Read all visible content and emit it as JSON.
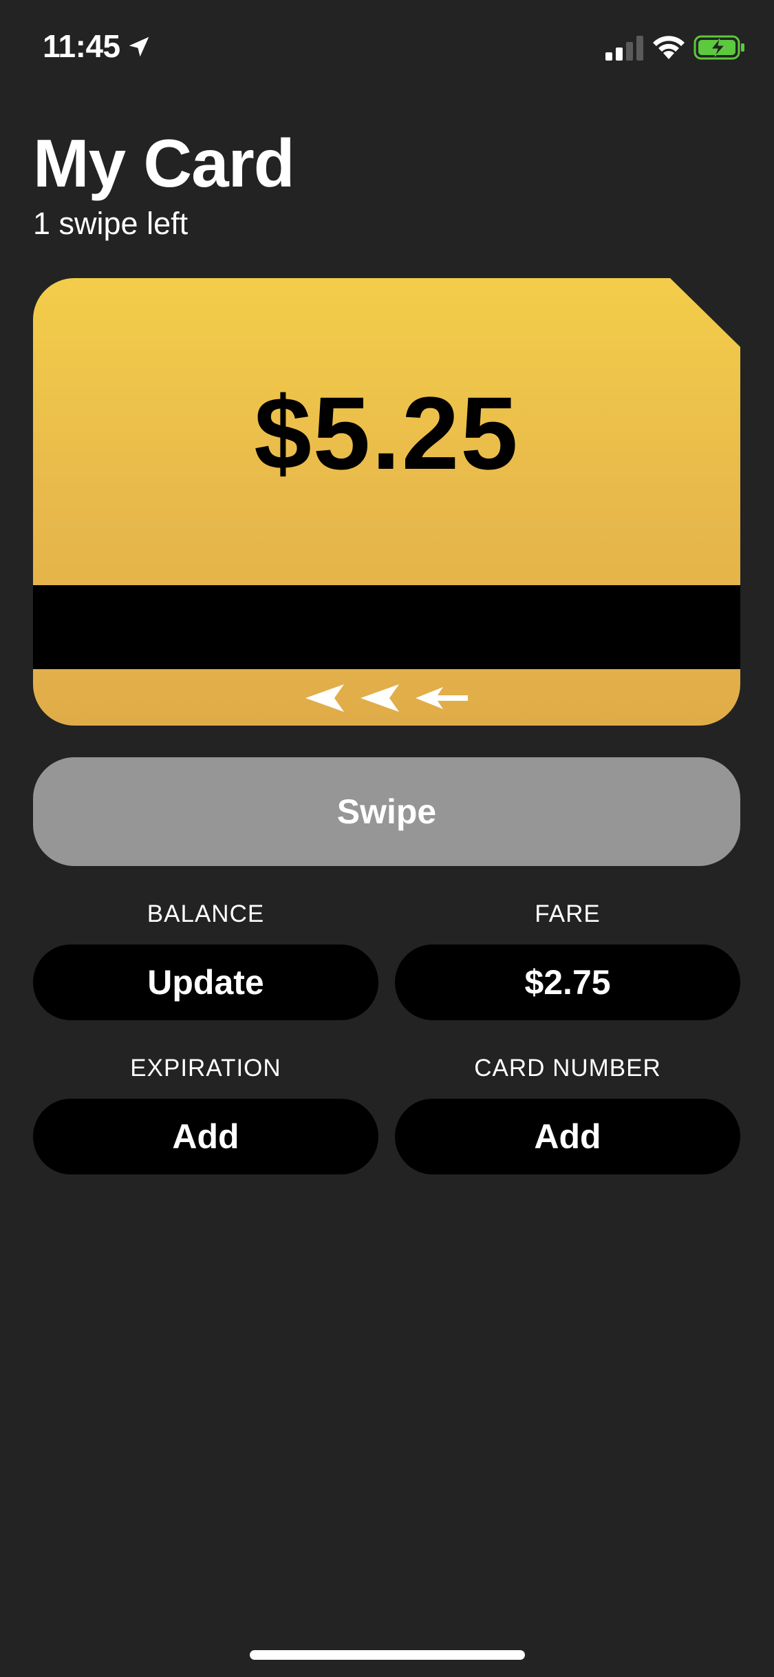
{
  "status_bar": {
    "time": "11:45",
    "icons": [
      "location-arrow-icon",
      "cellular-signal-icon",
      "wifi-icon",
      "battery-charging-icon"
    ]
  },
  "header": {
    "title": "My Card",
    "subtitle": "1 swipe left"
  },
  "card": {
    "balance": "$5.25",
    "colors": {
      "gradient_top": "#f3cd4a",
      "gradient_bottom": "#e0ac49",
      "stripe": "#000000"
    },
    "arrows_icon": "swipe-left-arrows-icon"
  },
  "swipe_button": {
    "label": "Swipe",
    "color": "#969696"
  },
  "fields": {
    "balance": {
      "label": "BALANCE",
      "value": "Update"
    },
    "fare": {
      "label": "FARE",
      "value": "$2.75"
    },
    "expiration": {
      "label": "EXPIRATION",
      "value": "Add"
    },
    "card_number": {
      "label": "CARD NUMBER",
      "value": "Add"
    }
  },
  "theme": {
    "background": "#232323",
    "battery_green": "#5cc93e"
  }
}
